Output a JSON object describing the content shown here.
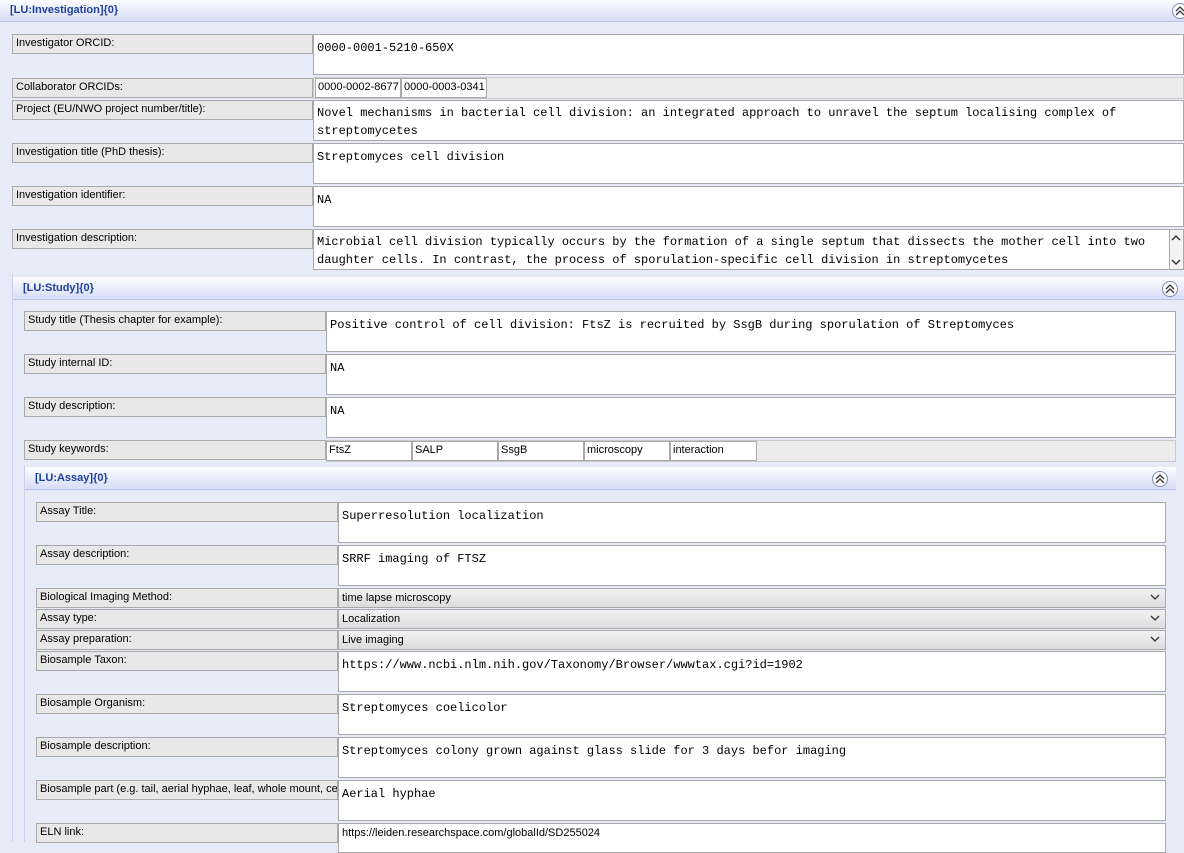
{
  "investigation": {
    "header": "[LU:Investigation]{0}",
    "orcid_label": "Investigator ORCID:",
    "orcid_value": "0000-0001-5210-650X",
    "collab_label": "Collaborator ORCIDs:",
    "collab_values": [
      "0000-0002-8677",
      "0000-0003-0341"
    ],
    "project_label": "Project (EU/NWO project number/title):",
    "project_value": "Novel mechanisms in bacterial cell division: an integrated approach to unravel the septum localising complex of streptomycetes",
    "title_label": "Investigation title (PhD thesis):",
    "title_value": "Streptomyces cell division",
    "identifier_label": "Investigation identifier:",
    "identifier_value": "NA",
    "description_label": "Investigation description:",
    "description_value": "Microbial cell division typically occurs by the formation of a single septum that dissects the mother cell into two daughter cells. In contrast, the process of sporulation-specific cell division in streptomycetes"
  },
  "study": {
    "header": "[LU:Study]{0}",
    "title_label": "Study title (Thesis chapter for example):",
    "title_value": "Positive control of cell division: FtsZ is recruited by SsgB during sporulation of Streptomyces",
    "internal_id_label": "Study internal ID:",
    "internal_id_value": "NA",
    "description_label": "Study description:",
    "description_value": "NA",
    "keywords_label": "Study keywords:",
    "keywords": [
      "FtsZ",
      "SALP",
      "SsgB",
      "microscopy",
      "interaction"
    ]
  },
  "assay": {
    "header": "[LU:Assay]{0}",
    "title_label": "Assay Title:",
    "title_value": "Superresolution localization",
    "description_label": "Assay description:",
    "description_value": "SRRF imaging of FTSZ",
    "imaging_label": "Biological Imaging Method:",
    "imaging_value": "time lapse microscopy",
    "type_label": "Assay type:",
    "type_value": "Localization",
    "prep_label": "Assay preparation:",
    "prep_value": "Live imaging",
    "taxon_label": "Biosample Taxon:",
    "taxon_value": "https://www.ncbi.nlm.nih.gov/Taxonomy/Browser/wwwtax.cgi?id=1902",
    "organism_label": "Biosample Organism:",
    "organism_value": "Streptomyces coelicolor",
    "bio_desc_label": "Biosample description:",
    "bio_desc_value": "Streptomyces colony grown against glass slide for 3 days befor imaging",
    "part_label": "Biosample part (e.g. tail, aerial hyphae, leaf, whole mount, cell",
    "part_value": "Aerial hyphae",
    "eln_label": "ELN link:",
    "eln_value": "https://leiden.researchspace.com/globalId/SD255024"
  }
}
